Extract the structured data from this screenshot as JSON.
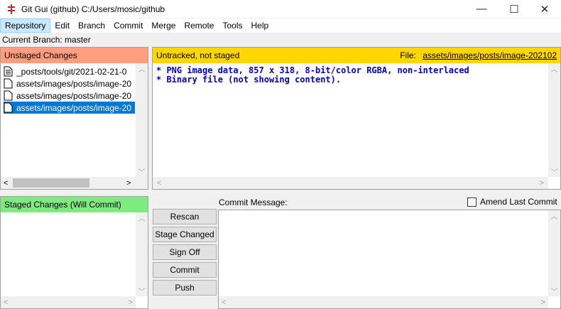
{
  "window": {
    "title": "Git Gui (github) C:/Users/mosic/github",
    "minimize_glyph": "—",
    "maximize_glyph": "☐",
    "close_glyph": "✕"
  },
  "menu": [
    "Repository",
    "Edit",
    "Branch",
    "Commit",
    "Merge",
    "Remote",
    "Tools",
    "Help"
  ],
  "branch": {
    "text": "Current Branch: master"
  },
  "unstaged": {
    "header": "Unstaged Changes",
    "header_color": "#ff9e7f",
    "files": [
      "_posts/tools/git/2021-02-21-0",
      "assets/images/posts/image-20",
      "assets/images/posts/image-20",
      "assets/images/posts/image-20"
    ]
  },
  "diff": {
    "status": "Untracked, not staged",
    "header_color": "#ffd700",
    "file_label": "File:",
    "file_path": "assets/images/posts/image-202102",
    "lines": [
      "* PNG image data, 857 x 318, 8-bit/color RGBA, non-interlaced",
      "* Binary file (not showing content)."
    ]
  },
  "staged": {
    "header": "Staged Changes (Will Commit)",
    "header_color": "#7fea7f"
  },
  "buttons": {
    "rescan": "Rescan",
    "stage_changed": "Stage Changed",
    "sign_off": "Sign Off",
    "commit": "Commit",
    "push": "Push"
  },
  "commit": {
    "label": "Commit Message:",
    "amend_label": "Amend Last Commit"
  }
}
